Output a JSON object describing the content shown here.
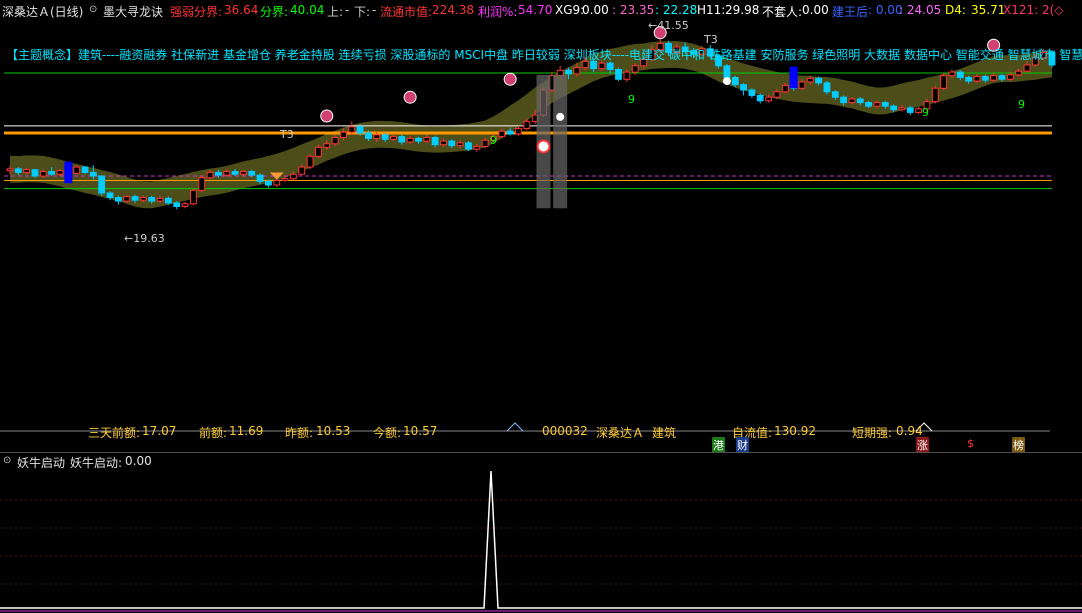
{
  "header": {
    "stock_name": "深桑达Ａ",
    "period": "(日线)",
    "indicator_name": "墨大寻龙诀",
    "weak_label": "强弱分界:",
    "weak_value": "36.64",
    "split_label": "分界:",
    "split_value": "40.04",
    "up_label": "上:",
    "up_value": "-",
    "down_label": "下:",
    "down_value": "-",
    "float_cap_label": "流通市值:",
    "float_cap_value": "224.38",
    "profit_label": "利润%:",
    "profit_value": "54.70",
    "xg9_label": "XG9:",
    "xg9_value": "0.00",
    "v1": ": 23.35",
    "v2": ": 22.28",
    "h11_label": "H11:",
    "h11_value": "29.98",
    "trap_label": "不套人:",
    "trap_value": "0.00",
    "king_label": "建王后",
    "king_value": ": 0.00",
    "v3": ": 24.05",
    "d4_label": "D4:",
    "d4_value": "35.71",
    "x121_label": "X121: 2(◇"
  },
  "concept_line": "【主题概念】建筑----融资融券 社保新进 基金增仓 养老金持股 连续亏损 深股通标的 MSCI中盘 昨日较弱 深圳板块----电建交 碳中和 铁路基建 安防服务 绿色照明 大数据 数据中心 智能交通 智慧城市 智慧政务",
  "annotations": {
    "high_price": "41.55",
    "low_price": "19.63",
    "t3_label": "T3",
    "t3_label2": "T3",
    "nine_a": "9",
    "nine_b": "9",
    "nine_c": "9",
    "nine_d": "9"
  },
  "stats": {
    "three_day_label": "三天前额:",
    "three_day_value": "17.07",
    "prev_label": "前额:",
    "prev_value": "11.69",
    "yest_label": "昨额:",
    "yest_value": "10.53",
    "today_label": "今额:",
    "today_value": "10.57",
    "code": "000032",
    "name": "深桑达Ａ",
    "sector": "建筑",
    "float_label": "自流值:",
    "float_value": "130.92",
    "short_label": "短期强:",
    "short_value": "0.94"
  },
  "badges": {
    "hk": "港",
    "fin": "财",
    "up": "涨",
    "dollar": "$",
    "rank": "榜"
  },
  "sub_panel": {
    "title": "妖牛启动",
    "series_label": "妖牛启动:",
    "series_value": "0.00"
  },
  "colors": {
    "up": "#ff3333",
    "down": "#00ccff",
    "band": "#5a5a1e",
    "orange": "#ff9900",
    "green": "#00cc00",
    "magenta": "#cc33cc",
    "white": "#ffffff"
  },
  "chart_data": [
    {
      "type": "candlestick",
      "title": "墨大寻龙诀",
      "y_range": [
        18.5,
        42.5
      ],
      "annotated_high": 41.55,
      "annotated_low": 19.63,
      "horizontal_levels": [
        {
          "value": 31.0,
          "color": "#ff9900"
        },
        {
          "value": 31.8,
          "color": "#ffffff"
        },
        {
          "value": 26.2,
          "color": "#cc33cc"
        },
        {
          "value": 25.7,
          "color": "#ff9900"
        },
        {
          "value": 24.8,
          "color": "#00cc00"
        },
        {
          "value": 37.7,
          "color": "#00cc00"
        }
      ],
      "candles": [
        [
          26.8,
          27.0,
          27.3,
          26.4
        ],
        [
          27.0,
          26.6,
          27.2,
          26.3
        ],
        [
          26.6,
          26.9,
          27.1,
          26.4
        ],
        [
          26.9,
          26.2,
          27.0,
          26.0
        ],
        [
          26.2,
          26.7,
          26.9,
          26.0
        ],
        [
          26.7,
          26.4,
          27.2,
          26.2
        ],
        [
          26.4,
          26.8,
          27.0,
          26.2
        ],
        [
          26.8,
          26.5,
          27.1,
          26.3
        ],
        [
          26.5,
          27.2,
          27.4,
          26.4
        ],
        [
          27.2,
          26.6,
          27.3,
          26.4
        ],
        [
          26.6,
          26.2,
          27.4,
          25.8
        ],
        [
          26.2,
          24.3,
          26.3,
          24.0
        ],
        [
          24.3,
          23.8,
          24.5,
          23.5
        ],
        [
          23.8,
          23.4,
          24.0,
          23.0
        ],
        [
          23.4,
          23.9,
          24.1,
          23.2
        ],
        [
          23.9,
          23.5,
          24.1,
          23.2
        ],
        [
          23.5,
          23.8,
          24.0,
          23.3
        ],
        [
          23.8,
          23.4,
          24.0,
          23.1
        ],
        [
          23.4,
          23.7,
          24.0,
          23.2
        ],
        [
          23.7,
          23.2,
          23.9,
          23.0
        ],
        [
          23.2,
          22.8,
          23.4,
          22.5
        ],
        [
          22.8,
          23.1,
          23.3,
          22.6
        ],
        [
          23.1,
          24.6,
          24.8,
          22.9
        ],
        [
          24.6,
          26.0,
          26.3,
          24.4
        ],
        [
          26.0,
          26.6,
          26.9,
          25.8
        ],
        [
          26.6,
          26.3,
          26.9,
          26.0
        ],
        [
          26.3,
          26.7,
          27.0,
          26.1
        ],
        [
          26.7,
          26.4,
          27.0,
          26.2
        ],
        [
          26.4,
          26.7,
          26.9,
          26.1
        ],
        [
          26.7,
          26.3,
          26.9,
          26.1
        ],
        [
          26.3,
          25.6,
          26.5,
          25.3
        ],
        [
          25.6,
          25.2,
          25.8,
          24.9
        ],
        [
          25.2,
          25.7,
          25.9,
          25.0
        ],
        [
          25.7,
          25.9,
          26.2,
          25.5
        ],
        [
          25.9,
          26.4,
          26.7,
          25.7
        ],
        [
          26.4,
          27.2,
          27.5,
          26.2
        ],
        [
          27.2,
          28.4,
          28.7,
          27.0
        ],
        [
          28.4,
          29.4,
          29.7,
          28.2
        ],
        [
          29.4,
          29.8,
          30.2,
          29.1
        ],
        [
          29.8,
          30.5,
          30.8,
          29.5
        ],
        [
          30.5,
          31.1,
          31.5,
          30.2
        ],
        [
          31.1,
          31.7,
          32.3,
          30.8
        ],
        [
          31.7,
          31.0,
          32.0,
          30.7
        ],
        [
          31.0,
          30.4,
          31.3,
          30.1
        ],
        [
          30.4,
          30.8,
          31.1,
          30.0
        ],
        [
          30.8,
          30.3,
          31.0,
          30.0
        ],
        [
          30.3,
          30.6,
          30.9,
          30.1
        ],
        [
          30.6,
          30.0,
          30.8,
          29.7
        ],
        [
          30.0,
          30.4,
          30.7,
          29.8
        ],
        [
          30.4,
          30.1,
          30.6,
          29.8
        ],
        [
          30.1,
          30.5,
          30.8,
          29.9
        ],
        [
          30.5,
          29.7,
          30.7,
          29.4
        ],
        [
          29.7,
          30.1,
          30.4,
          29.5
        ],
        [
          30.1,
          29.6,
          30.3,
          29.3
        ],
        [
          29.6,
          29.9,
          30.2,
          29.3
        ],
        [
          29.9,
          29.2,
          30.1,
          29.0
        ],
        [
          29.2,
          29.5,
          29.8,
          28.9
        ],
        [
          29.5,
          30.2,
          30.5,
          29.3
        ],
        [
          30.2,
          30.6,
          30.9,
          30.0
        ],
        [
          30.6,
          31.2,
          31.5,
          30.4
        ],
        [
          31.2,
          30.9,
          31.6,
          30.7
        ],
        [
          30.9,
          31.5,
          31.8,
          30.7
        ],
        [
          31.5,
          32.3,
          32.6,
          31.3
        ],
        [
          32.3,
          33.0,
          33.6,
          32.0
        ],
        [
          33.0,
          35.8,
          36.2,
          32.8
        ],
        [
          35.8,
          37.4,
          37.8,
          35.5
        ],
        [
          37.4,
          38.0,
          38.5,
          36.9
        ],
        [
          38.0,
          37.6,
          38.3,
          37.0
        ],
        [
          37.6,
          38.3,
          38.8,
          37.3
        ],
        [
          38.3,
          39.0,
          39.5,
          38.0
        ],
        [
          39.0,
          38.2,
          39.3,
          37.8
        ],
        [
          38.2,
          38.8,
          39.1,
          37.9
        ],
        [
          38.8,
          38.1,
          39.0,
          37.6
        ],
        [
          38.1,
          37.0,
          38.3,
          36.8
        ],
        [
          37.0,
          37.8,
          38.1,
          36.7
        ],
        [
          37.8,
          38.5,
          38.8,
          37.5
        ],
        [
          38.5,
          39.2,
          39.5,
          38.2
        ],
        [
          39.2,
          40.3,
          40.8,
          39.0
        ],
        [
          40.3,
          41.0,
          41.55,
          40.0
        ],
        [
          41.0,
          40.0,
          41.3,
          39.6
        ],
        [
          40.0,
          40.6,
          41.0,
          39.7
        ],
        [
          40.6,
          40.2,
          41.1,
          39.8
        ],
        [
          40.2,
          39.8,
          40.5,
          39.4
        ],
        [
          39.8,
          40.4,
          40.7,
          39.6
        ],
        [
          40.4,
          39.6,
          40.8,
          39.3
        ],
        [
          39.6,
          38.5,
          39.8,
          38.2
        ],
        [
          38.5,
          37.2,
          38.7,
          37.0
        ],
        [
          37.2,
          36.4,
          37.4,
          36.1
        ],
        [
          36.4,
          35.8,
          36.6,
          35.2
        ],
        [
          35.8,
          35.2,
          36.0,
          34.9
        ],
        [
          35.2,
          34.6,
          35.4,
          34.3
        ],
        [
          34.6,
          35.0,
          35.3,
          34.4
        ],
        [
          35.0,
          35.6,
          35.9,
          34.8
        ],
        [
          35.6,
          36.3,
          36.6,
          35.4
        ],
        [
          36.3,
          36.0,
          36.6,
          35.7
        ],
        [
          36.0,
          36.7,
          37.0,
          35.8
        ],
        [
          36.7,
          37.1,
          37.4,
          36.4
        ],
        [
          37.1,
          36.6,
          37.3,
          36.3
        ],
        [
          36.6,
          35.6,
          36.8,
          35.3
        ],
        [
          35.6,
          35.0,
          35.8,
          34.7
        ],
        [
          35.0,
          34.4,
          35.2,
          34.1
        ],
        [
          34.4,
          34.8,
          35.0,
          34.2
        ],
        [
          34.8,
          34.4,
          35.0,
          34.1
        ],
        [
          34.4,
          34.0,
          34.6,
          33.8
        ],
        [
          34.0,
          34.4,
          34.6,
          33.8
        ],
        [
          34.4,
          34.0,
          34.6,
          33.7
        ],
        [
          34.0,
          33.6,
          34.2,
          33.3
        ],
        [
          33.6,
          33.8,
          34.1,
          33.4
        ],
        [
          33.8,
          33.3,
          34.0,
          33.0
        ],
        [
          33.3,
          33.7,
          33.9,
          33.1
        ],
        [
          33.7,
          34.5,
          34.8,
          33.5
        ],
        [
          34.5,
          36.0,
          36.3,
          34.3
        ],
        [
          36.0,
          37.4,
          37.7,
          35.8
        ],
        [
          37.4,
          37.8,
          38.1,
          37.1
        ],
        [
          37.8,
          37.2,
          38.0,
          36.9
        ],
        [
          37.2,
          36.8,
          37.4,
          36.5
        ],
        [
          36.8,
          37.3,
          37.6,
          36.6
        ],
        [
          37.3,
          36.9,
          37.5,
          36.6
        ],
        [
          36.9,
          37.4,
          37.7,
          36.7
        ],
        [
          37.4,
          37.0,
          37.6,
          36.7
        ],
        [
          37.0,
          37.5,
          37.8,
          36.8
        ],
        [
          37.5,
          37.9,
          38.2,
          37.3
        ],
        [
          37.9,
          38.6,
          39.0,
          37.7
        ],
        [
          38.6,
          39.4,
          39.8,
          38.4
        ],
        [
          39.4,
          40.0,
          40.4,
          39.1
        ],
        [
          40.0,
          38.6,
          40.2,
          38.3
        ]
      ]
    },
    {
      "type": "line",
      "title": "妖牛启动",
      "series": [
        {
          "name": "妖牛启动",
          "value": 0.0
        }
      ],
      "spike_index": 108,
      "y_range": [
        0,
        1
      ]
    }
  ]
}
